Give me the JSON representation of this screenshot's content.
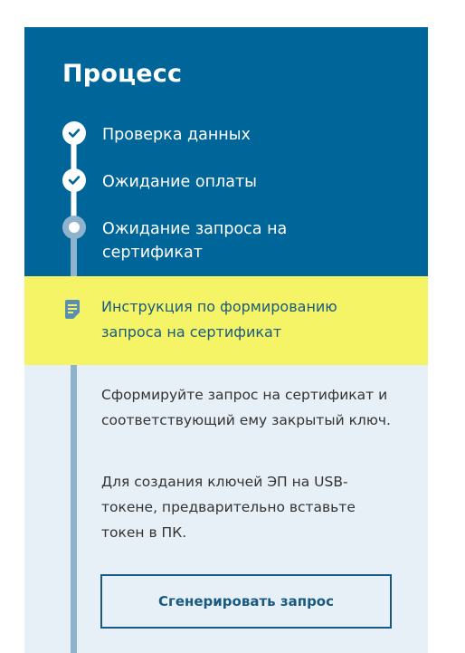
{
  "process": {
    "title": "Процесс",
    "steps": [
      {
        "label": "Проверка данных",
        "status": "done",
        "icon": "check-icon"
      },
      {
        "label": "Ожидание оплаты",
        "status": "done",
        "icon": "check-icon"
      },
      {
        "label": "Ожидание запроса на сертификат",
        "status": "current",
        "icon": "current-step-icon"
      }
    ],
    "instruction": {
      "label": "Инструкция по формированию запроса на сертификат",
      "icon": "document-icon"
    },
    "body": {
      "paragraph1": "Сформируйте запрос на сертификат и соответствующий ему закрытый ключ.",
      "paragraph2": "Для создания ключей ЭП на USB-токене, предварительно вставьте токен в ПК."
    },
    "generate_button_label": "Сгенерировать запрос"
  },
  "colors": {
    "header_background": "#006699",
    "instruction_background": "#f4f466",
    "panel_background": "#e8f0f7",
    "accent": "#1a5a80",
    "timeline": "#8fb3cc"
  }
}
